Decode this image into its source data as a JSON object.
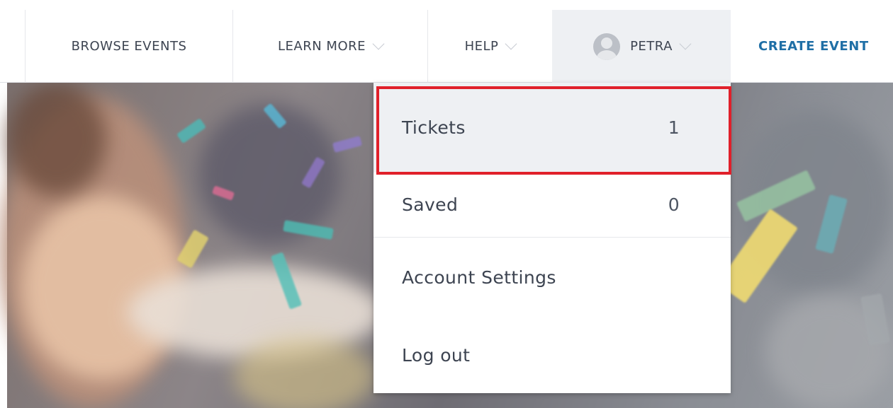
{
  "nav": {
    "browse_events": "BROWSE EVENTS",
    "learn_more": "LEARN MORE",
    "help": "HELP",
    "user_name": "PETRA",
    "create_event": "CREATE EVENT"
  },
  "user_menu": {
    "items": [
      {
        "label": "Tickets",
        "count": "1"
      },
      {
        "label": "Saved",
        "count": "0"
      },
      {
        "label": "Account Settings"
      },
      {
        "label": "Log out"
      }
    ]
  },
  "colors": {
    "accent_link": "#1f6fa6",
    "highlight_border": "#e0202a",
    "menu_hover_bg": "#eef0f3"
  },
  "icons": {
    "user_avatar": "avatar-icon",
    "dropdown_chevron": "chevron-down-icon"
  }
}
